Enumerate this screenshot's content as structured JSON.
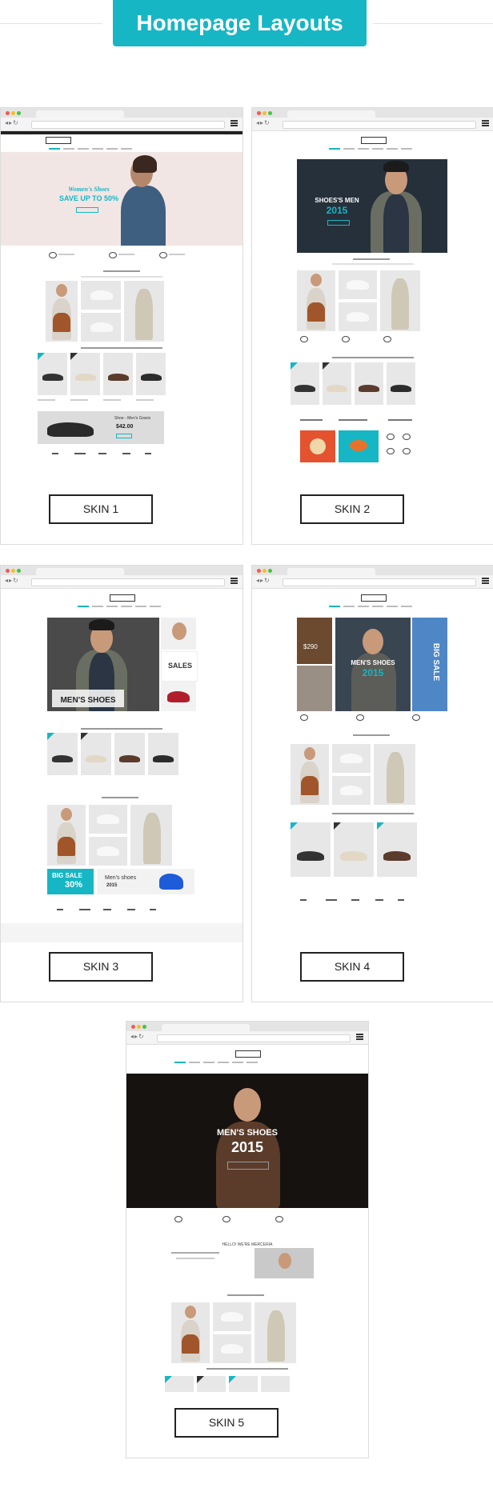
{
  "header": {
    "title": "Homepage Layouts",
    "accent": "#17b6c4"
  },
  "skins": [
    {
      "id": 1,
      "label": "SKIN 1",
      "hero_title": "Women's Shoes",
      "hero_subtitle": "SAVE UP TO 50%",
      "promo_label": "Shoe - Men's Gravis",
      "promo_price": "$42.00"
    },
    {
      "id": 2,
      "label": "SKIN 2",
      "hero_title": "SHOES'S MEN",
      "hero_year": "2015"
    },
    {
      "id": 3,
      "label": "SKIN 3",
      "hero_title": "MEN'S SHOES",
      "side_title": "SALES",
      "big_sale": "BIG SALE",
      "big_sale_pct": "30%",
      "mens_shoes": "Men's shoes",
      "mens_year": "2015"
    },
    {
      "id": 4,
      "label": "SKIN 4",
      "hero_title": "MEN'S SHOES",
      "hero_year": "2015",
      "side_price": "$290",
      "big_sale": "BIG SALE"
    },
    {
      "id": 5,
      "label": "SKIN 5",
      "hero_title": "MEN'S SHOES",
      "hero_year": "2015",
      "hello": "HELLO! WE'RE MERCERIA"
    }
  ]
}
